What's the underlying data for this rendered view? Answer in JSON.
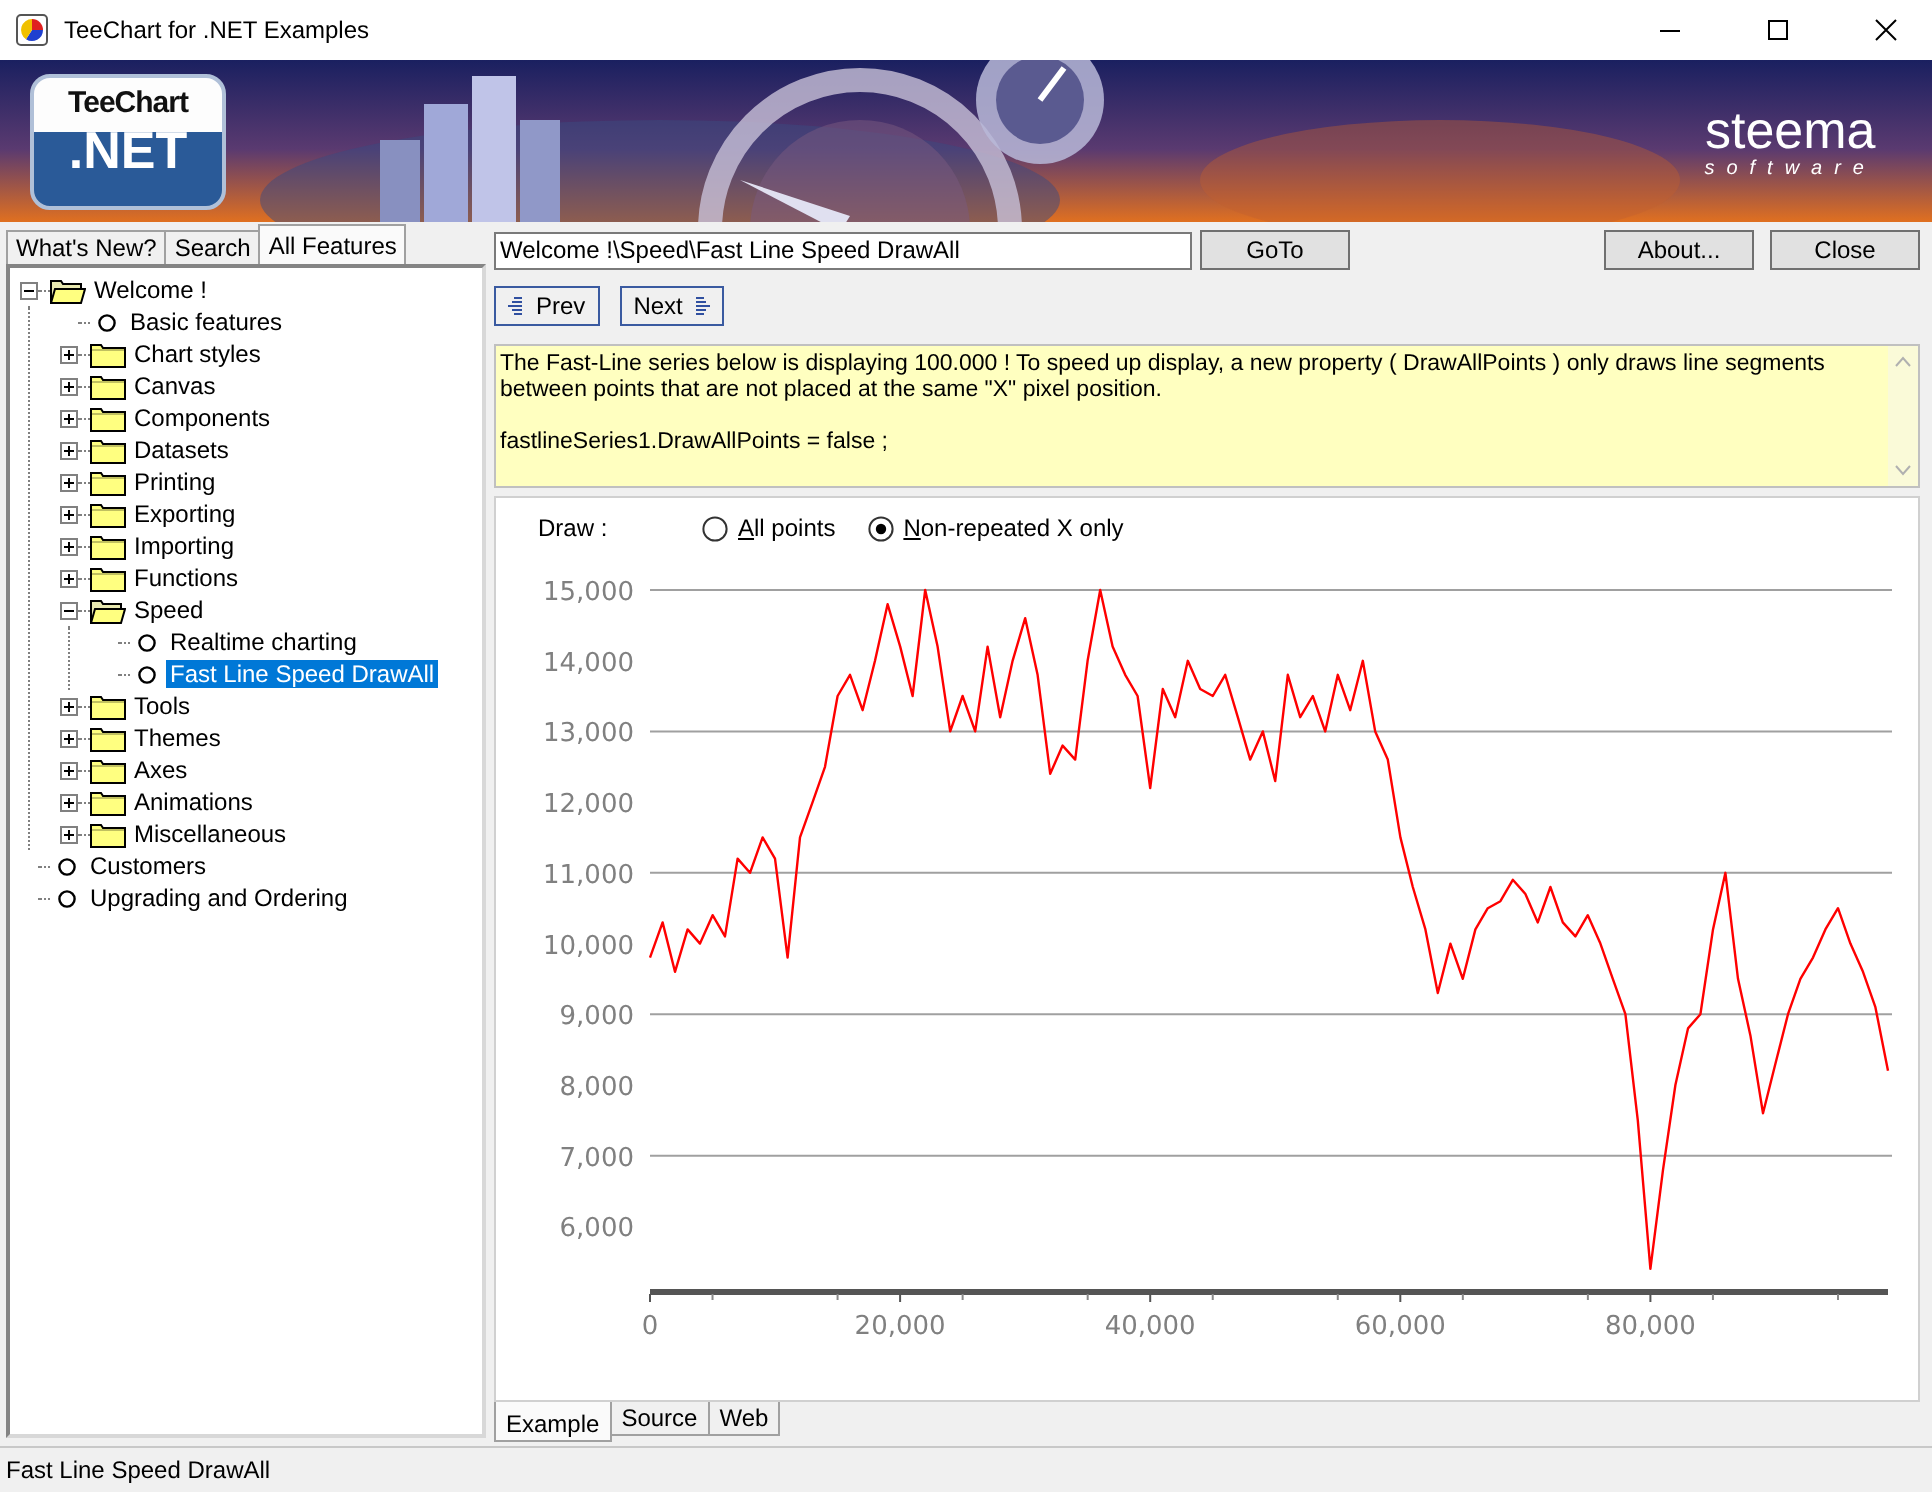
{
  "window": {
    "title": "TeeChart for .NET Examples"
  },
  "banner": {
    "logo_top": "TeeChart",
    "logo_bottom": ".NET",
    "brand": "steema",
    "brand_sub": "software"
  },
  "left_tabs": [
    {
      "label": "What's New?",
      "selected": false
    },
    {
      "label": "Search",
      "selected": false
    },
    {
      "label": "All Features",
      "selected": true
    }
  ],
  "tree": [
    {
      "label": "Welcome !",
      "kind": "folder",
      "expanded": true,
      "selected": false,
      "children": [
        {
          "label": "Basic features",
          "kind": "leaf",
          "selected": false
        },
        {
          "label": "Chart styles",
          "kind": "folder",
          "expanded": false,
          "selected": false
        },
        {
          "label": "Canvas",
          "kind": "folder",
          "expanded": false,
          "selected": false
        },
        {
          "label": "Components",
          "kind": "folder",
          "expanded": false,
          "selected": false
        },
        {
          "label": "Datasets",
          "kind": "folder",
          "expanded": false,
          "selected": false
        },
        {
          "label": "Printing",
          "kind": "folder",
          "expanded": false,
          "selected": false
        },
        {
          "label": "Exporting",
          "kind": "folder",
          "expanded": false,
          "selected": false
        },
        {
          "label": "Importing",
          "kind": "folder",
          "expanded": false,
          "selected": false
        },
        {
          "label": "Functions",
          "kind": "folder",
          "expanded": false,
          "selected": false
        },
        {
          "label": "Speed",
          "kind": "folder",
          "expanded": true,
          "selected": false,
          "children": [
            {
              "label": "Realtime charting",
              "kind": "leaf",
              "selected": false
            },
            {
              "label": "Fast Line Speed DrawAll",
              "kind": "leaf",
              "selected": true
            }
          ]
        },
        {
          "label": "Tools",
          "kind": "folder",
          "expanded": false,
          "selected": false
        },
        {
          "label": "Themes",
          "kind": "folder",
          "expanded": false,
          "selected": false
        },
        {
          "label": "Axes",
          "kind": "folder",
          "expanded": false,
          "selected": false
        },
        {
          "label": "Animations",
          "kind": "folder",
          "expanded": false,
          "selected": false
        },
        {
          "label": "Miscellaneous",
          "kind": "folder",
          "expanded": false,
          "selected": false
        }
      ]
    },
    {
      "label": "Customers",
      "kind": "leaf",
      "selected": false
    },
    {
      "label": "Upgrading and Ordering",
      "kind": "leaf",
      "selected": false
    }
  ],
  "toolbar": {
    "path": "Welcome !\\Speed\\Fast Line Speed DrawAll",
    "goto": "GoTo",
    "about": "About...",
    "close": "Close",
    "prev": "Prev",
    "next": "Next"
  },
  "description": {
    "text": "The Fast-Line series below is displaying 100.000 ! To speed up display, a new property ( DrawAllPoints ) only draws line segments between points that are not placed at the same \"X\" pixel position.",
    "code": "fastlineSeries1.DrawAllPoints = false ;"
  },
  "draw_option": {
    "label": "Draw :",
    "options": [
      {
        "label": "All points",
        "selected": false
      },
      {
        "label": "Non-repeated X only",
        "selected": true
      }
    ]
  },
  "chart": {
    "chart_data": {
      "type": "line",
      "grid": true,
      "xlim": [
        0,
        99000
      ],
      "ylim": [
        5100,
        15000
      ],
      "xticks": [
        {
          "value": 0,
          "label": "0"
        },
        {
          "value": 20000,
          "label": "20,000"
        },
        {
          "value": 40000,
          "label": "40,000"
        },
        {
          "value": 60000,
          "label": "60,000"
        },
        {
          "value": 80000,
          "label": "80,000"
        }
      ],
      "yticks": [
        {
          "value": 6000,
          "label": "6,000"
        },
        {
          "value": 7000,
          "label": "7,000"
        },
        {
          "value": 8000,
          "label": "8,000"
        },
        {
          "value": 9000,
          "label": "9,000"
        },
        {
          "value": 10000,
          "label": "10,000"
        },
        {
          "value": 11000,
          "label": "11,000"
        },
        {
          "value": 12000,
          "label": "12,000"
        },
        {
          "value": 13000,
          "label": "13,000"
        },
        {
          "value": 14000,
          "label": "14,000"
        },
        {
          "value": 15000,
          "label": "15,000"
        }
      ],
      "x": [
        0,
        1000,
        2000,
        3000,
        4000,
        5000,
        6000,
        7000,
        8000,
        9000,
        10000,
        11000,
        12000,
        13000,
        14000,
        15000,
        16000,
        17000,
        18000,
        19000,
        20000,
        21000,
        22000,
        23000,
        24000,
        25000,
        26000,
        27000,
        28000,
        29000,
        30000,
        31000,
        32000,
        33000,
        34000,
        35000,
        36000,
        37000,
        38000,
        39000,
        40000,
        41000,
        42000,
        43000,
        44000,
        45000,
        46000,
        47000,
        48000,
        49000,
        50000,
        51000,
        52000,
        53000,
        54000,
        55000,
        56000,
        57000,
        58000,
        59000,
        60000,
        61000,
        62000,
        63000,
        64000,
        65000,
        66000,
        67000,
        68000,
        69000,
        70000,
        71000,
        72000,
        73000,
        74000,
        75000,
        76000,
        77000,
        78000,
        79000,
        80000,
        81000,
        82000,
        83000,
        84000,
        85000,
        86000,
        87000,
        88000,
        89000,
        90000,
        91000,
        92000,
        93000,
        94000,
        95000,
        96000,
        97000,
        98000,
        99000
      ],
      "series": [
        {
          "color": "#ff0000",
          "values": [
            9800,
            10300,
            9600,
            10200,
            10000,
            10400,
            10100,
            11200,
            11000,
            11500,
            11200,
            9800,
            11500,
            12000,
            12500,
            13500,
            13800,
            13300,
            14000,
            14800,
            14200,
            13500,
            15000,
            14200,
            13000,
            13500,
            13000,
            14200,
            13200,
            14000,
            14600,
            13800,
            12400,
            12800,
            12600,
            14000,
            15000,
            14200,
            13800,
            13500,
            12200,
            13600,
            13200,
            14000,
            13600,
            13500,
            13800,
            13200,
            12600,
            13000,
            12300,
            13800,
            13200,
            13500,
            13000,
            13800,
            13300,
            14000,
            13000,
            12600,
            11500,
            10800,
            10200,
            9300,
            10000,
            9500,
            10200,
            10500,
            10600,
            10900,
            10700,
            10300,
            10800,
            10300,
            10100,
            10400,
            10000,
            9500,
            9000,
            7500,
            5400,
            6800,
            8000,
            8800,
            9000,
            10200,
            11000,
            9500,
            8700,
            7600,
            8300,
            9000,
            9500,
            9800,
            10200,
            10500,
            10000,
            9600,
            9100,
            8200
          ]
        }
      ]
    }
  },
  "bottom_tabs": [
    {
      "label": "Example",
      "selected": true
    },
    {
      "label": "Source",
      "selected": false
    },
    {
      "label": "Web",
      "selected": false
    }
  ],
  "status_bar": "Fast Line Speed DrawAll"
}
